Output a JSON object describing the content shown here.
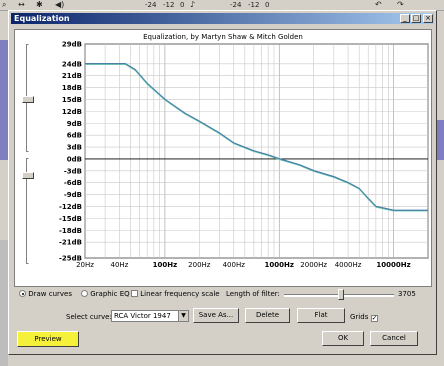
{
  "bg_toolbar": {
    "items": [
      "-24",
      "-12",
      "0",
      "-24",
      "-12",
      "0"
    ]
  },
  "window": {
    "title": "Equalization",
    "controls": {
      "minimize": "_",
      "maximize": "□",
      "close": "×"
    }
  },
  "chart_data": {
    "type": "line",
    "title": "Equalization, by Martyn Shaw & Mitch Golden",
    "y_ticks": [
      "29dB",
      "24dB",
      "21dB",
      "18dB",
      "15dB",
      "12dB",
      "9dB",
      "6dB",
      "3dB",
      "0dB",
      "-3dB",
      "-6dB",
      "-9dB",
      "-12dB",
      "-15dB",
      "-18dB",
      "-21dB",
      "-25dB"
    ],
    "y_range": [
      -25,
      29
    ],
    "x_ticks": [
      "20Hz",
      "40Hz",
      "100Hz",
      "200Hz",
      "400Hz",
      "1000Hz",
      "2000Hz",
      "4000Hz",
      "10000Hz"
    ],
    "x_range": [
      20,
      20000
    ],
    "x_scale": "log",
    "grid": true,
    "series": [
      {
        "x": [
          20,
          45,
          55,
          70,
          100,
          150,
          200,
          300,
          400,
          600,
          800,
          1000,
          1500,
          2000,
          3000,
          4000,
          5000,
          6000,
          7000,
          10000,
          20000
        ],
        "values": [
          24,
          24,
          22.5,
          19,
          15,
          11.5,
          9.5,
          6.5,
          4,
          2,
          1,
          0,
          -1.5,
          -3,
          -4.5,
          -6,
          -7.5,
          -10,
          -12,
          -13,
          -13
        ]
      }
    ],
    "line_color": "#4a7fa8"
  },
  "left_slider_labels": {},
  "options": {
    "draw_curves": "Draw curves",
    "graphic_eq": "Graphic EQ",
    "linear_freq": "Linear frequency scale",
    "length_label": "Length of filter:",
    "length_value": "3705",
    "length_fraction": 0.52
  },
  "curve_row": {
    "select_label": "Select curve:",
    "selected": "RCA Victor 1947",
    "save_as": "Save As...",
    "delete": "Delete",
    "flat": "Flat",
    "grids": "Grids"
  },
  "footer": {
    "preview": "Preview",
    "ok": "OK",
    "cancel": "Cancel"
  },
  "colors": {
    "preview_highlight": "#f5f03a",
    "title_bar": "#0a246a"
  }
}
